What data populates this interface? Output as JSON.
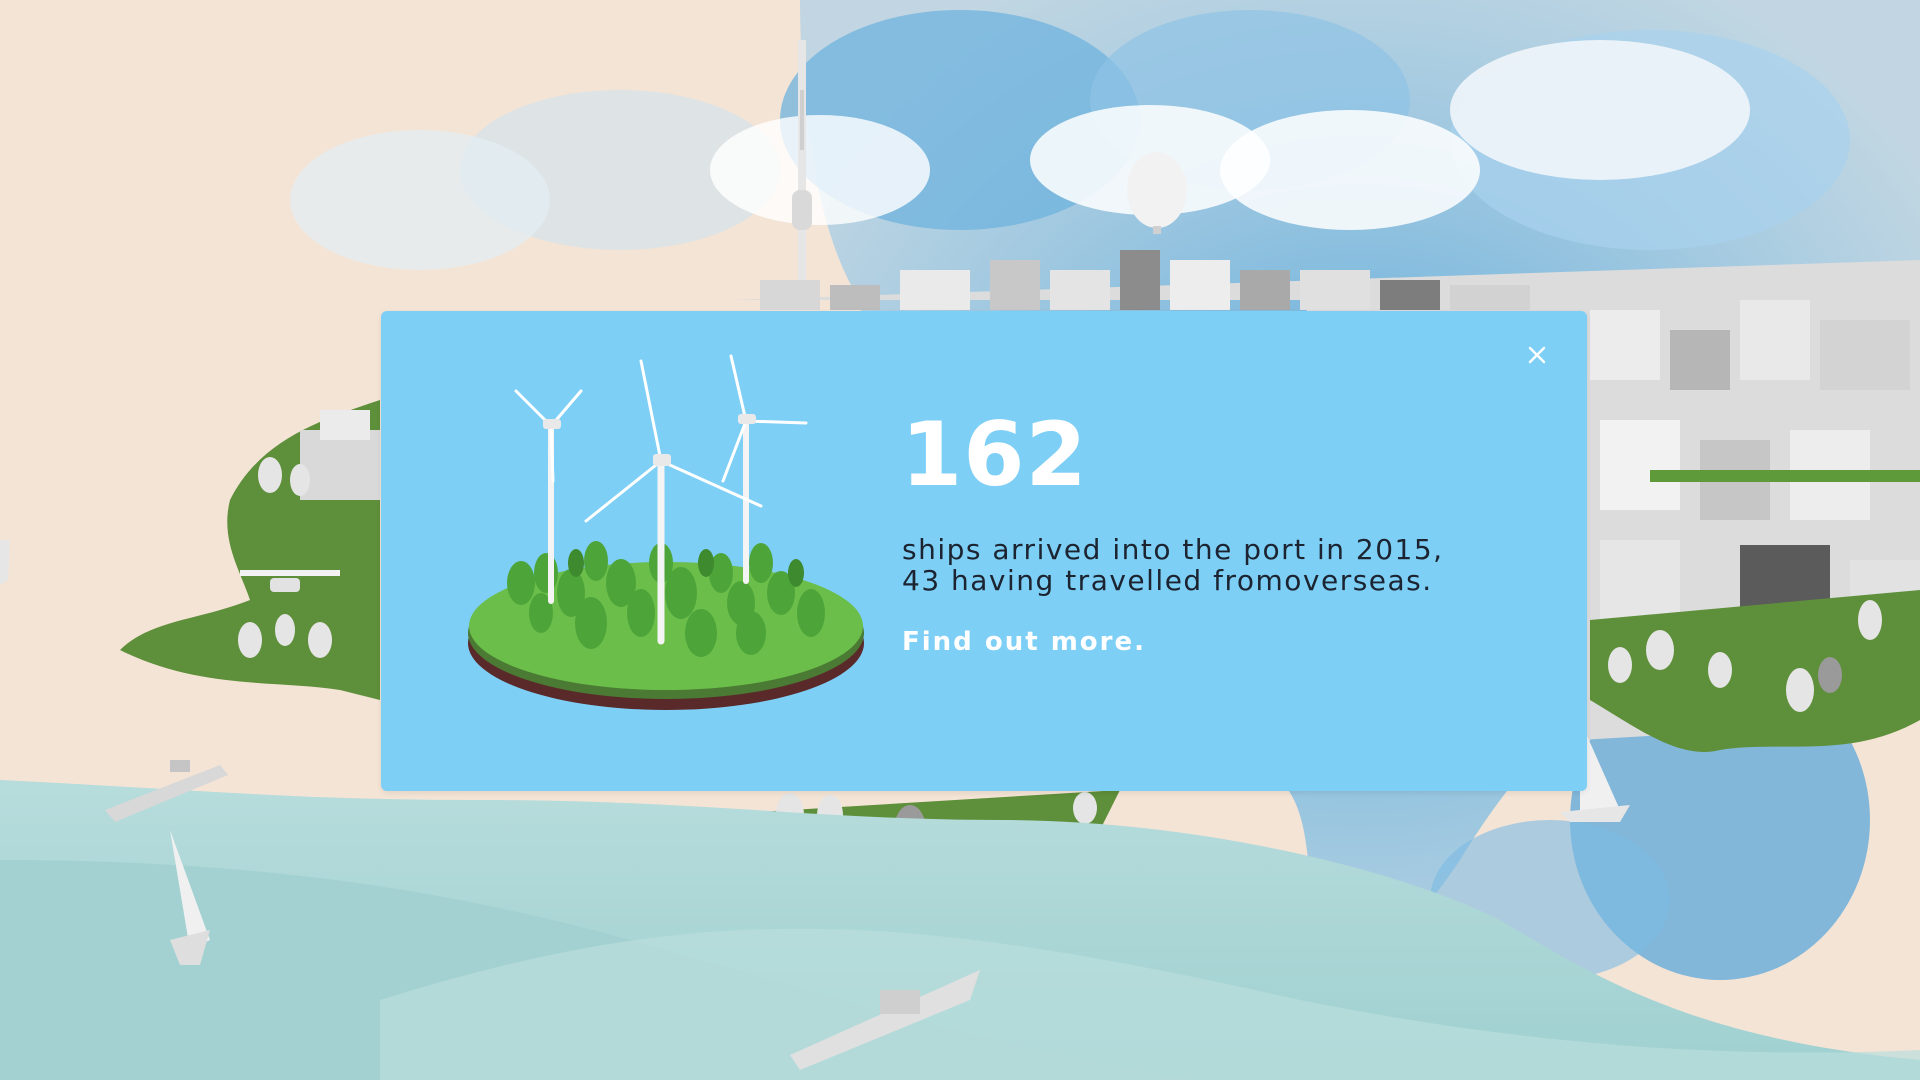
{
  "modal": {
    "stat_number": "162",
    "description_line1": "ships arrived into the port in 2015,",
    "description_line2": "43 having travelled fromoverseas.",
    "cta_label": "Find out more.",
    "close_icon": "close-icon",
    "illustration": "wind-turbine-island"
  },
  "colors": {
    "modal_background": "#7ecff6",
    "stat_number": "#ffffff",
    "description_text": "#1b2430",
    "link_text": "#ffffff",
    "land_green": "#5e8f3a",
    "water": "#a9d7d8",
    "paper_background": "#f4e4d6"
  }
}
